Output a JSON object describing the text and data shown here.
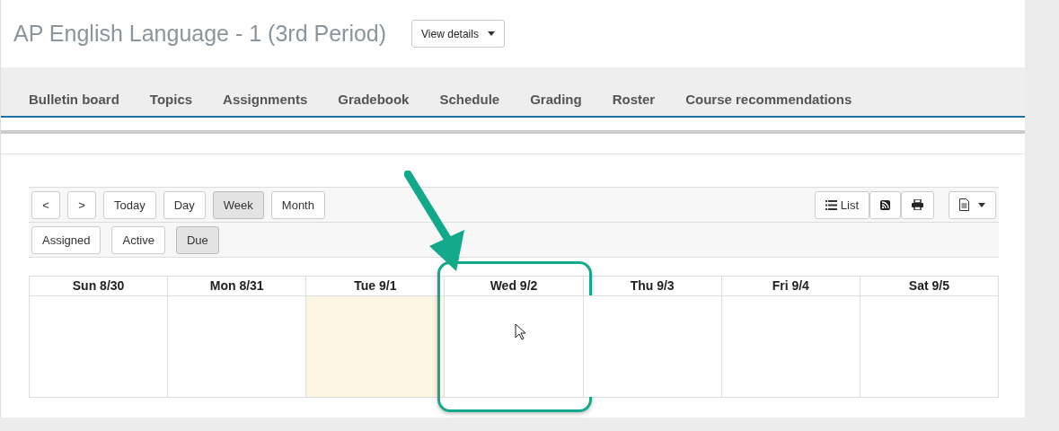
{
  "header": {
    "title": "AP English Language - 1 (3rd Period)",
    "details_button": "View details"
  },
  "tabs": [
    {
      "label": "Bulletin board",
      "selected": false
    },
    {
      "label": "Topics",
      "selected": false
    },
    {
      "label": "Assignments",
      "selected": false
    },
    {
      "label": "Gradebook",
      "selected": false
    },
    {
      "label": "Schedule",
      "selected": false
    },
    {
      "label": "Grading",
      "selected": false
    },
    {
      "label": "Roster",
      "selected": false
    },
    {
      "label": "Course recommendations",
      "selected": false
    }
  ],
  "view_buttons": [
    {
      "label": "<",
      "selected": false
    },
    {
      "label": ">",
      "selected": false
    },
    {
      "label": "Today",
      "selected": false
    },
    {
      "label": "Day",
      "selected": false
    },
    {
      "label": "Week",
      "selected": true
    },
    {
      "label": "Month",
      "selected": false
    }
  ],
  "tool_buttons": [
    {
      "kind": "list",
      "label": "List"
    },
    {
      "kind": "rss"
    },
    {
      "kind": "print"
    },
    {
      "kind": "export"
    }
  ],
  "filter_buttons": [
    {
      "label": "Assigned",
      "selected": false
    },
    {
      "label": "Active",
      "selected": false
    },
    {
      "label": "Due",
      "selected": true
    }
  ],
  "days": [
    {
      "label": "Sun 8/30",
      "today": false,
      "annotated": false
    },
    {
      "label": "Mon 8/31",
      "today": false,
      "annotated": false
    },
    {
      "label": "Tue 9/1",
      "today": true,
      "annotated": false
    },
    {
      "label": "Wed 9/2",
      "today": false,
      "annotated": true
    },
    {
      "label": "Thu 9/3",
      "today": false,
      "annotated": false
    },
    {
      "label": "Fri 9/4",
      "today": false,
      "annotated": false
    },
    {
      "label": "Sat 9/5",
      "today": false,
      "annotated": false
    }
  ]
}
